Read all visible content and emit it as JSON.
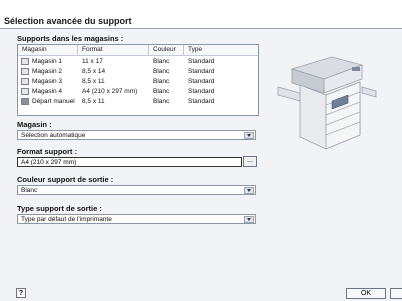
{
  "window": {
    "title": "Sélection avancée du support"
  },
  "trays": {
    "label": "Supports dans les magasins :",
    "columns": [
      "Magasin",
      "Format",
      "Couleur",
      "Type"
    ],
    "rows": [
      {
        "tray": "Magasin 1",
        "format": "11 x 17",
        "color": "Blanc",
        "type": "Standard",
        "icon": "tray-icon"
      },
      {
        "tray": "Magasin 2",
        "format": "8,5 x 14",
        "color": "Blanc",
        "type": "Standard",
        "icon": "tray-icon"
      },
      {
        "tray": "Magasin 3",
        "format": "8,5 x 11",
        "color": "Blanc",
        "type": "Standard",
        "icon": "tray-icon"
      },
      {
        "tray": "Magasin 4",
        "format": "A4 (210 x 297 mm)",
        "color": "Blanc",
        "type": "Standard",
        "icon": "tray-icon"
      },
      {
        "tray": "Départ manuel",
        "format": "8,5 x 11",
        "color": "Blanc",
        "type": "Standard",
        "icon": "bypass-tray-icon"
      }
    ]
  },
  "magasin": {
    "label": "Magasin :",
    "value": "Sélection automatique"
  },
  "format_support": {
    "label": "Format support :",
    "value": "A4 (210 x 297 mm)",
    "button": "..."
  },
  "couleur": {
    "label": "Couleur support de sortie :",
    "value": "Blanc"
  },
  "type_support": {
    "label": "Type support de sortie :",
    "value": "Type par défaut de l'imprimante"
  },
  "footer": {
    "help": "?",
    "ok": "OK"
  }
}
